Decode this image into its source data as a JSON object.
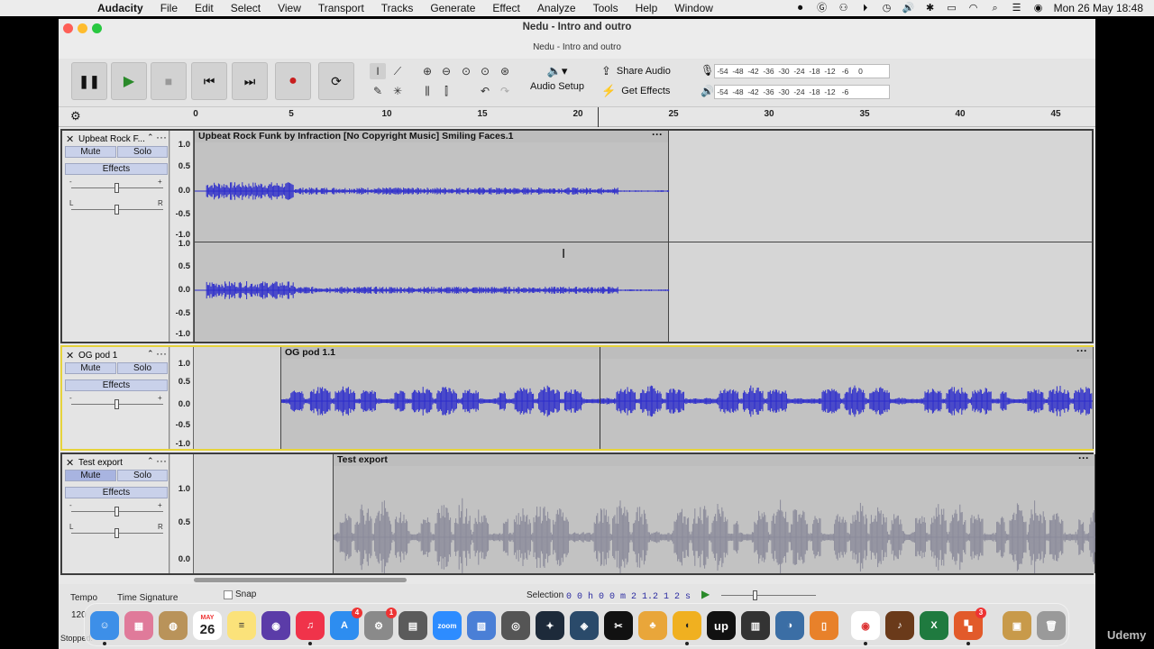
{
  "menubar": {
    "app_name": "Audacity",
    "items": [
      "File",
      "Edit",
      "Select",
      "View",
      "Transport",
      "Tracks",
      "Generate",
      "Effect",
      "Analyze",
      "Tools",
      "Help",
      "Window"
    ],
    "datetime": "Mon 26 May  18:48"
  },
  "window": {
    "title": "Nedu - Intro and outro",
    "subtitle": "Nedu - Intro and outro"
  },
  "toolbar": {
    "share_audio": "Share Audio",
    "get_effects": "Get Effects",
    "audio_setup": "Audio Setup",
    "meter_ticks": [
      "-54",
      "-48",
      "-42",
      "-36",
      "-30",
      "-24",
      "-18",
      "-12",
      "-6",
      "0"
    ],
    "meter_ticks_play": [
      "-54",
      "-48",
      "-42",
      "-36",
      "-30",
      "-24",
      "-18",
      "-12",
      "-6",
      ""
    ]
  },
  "ruler": {
    "ticks": [
      "0",
      "5",
      "10",
      "15",
      "20",
      "25",
      "30",
      "35",
      "40",
      "45"
    ]
  },
  "tracks": [
    {
      "name": "Upbeat Rock F...",
      "mute": "Mute",
      "solo": "Solo",
      "effects": "Effects",
      "clip_title": "Upbeat Rock Funk by Infraction [No Copyright Music]  Smiling Faces.1",
      "scale_top": [
        "1.0",
        "0.5",
        "0.0",
        "-0.5",
        "-1.0"
      ],
      "scale_bottom": [
        "1.0",
        "0.5",
        "0.0",
        "-0.5",
        "-1.0"
      ],
      "pan_l": "L",
      "pan_r": "R",
      "gain_minus": "-",
      "gain_plus": "+"
    },
    {
      "name": "OG pod 1",
      "mute": "Mute",
      "solo": "Solo",
      "effects": "Effects",
      "clip_title": "OG pod 1.1",
      "scale": [
        "1.0",
        "0.5",
        "0.0",
        "-0.5",
        "-1.0"
      ],
      "gain_minus": "-",
      "gain_plus": "+"
    },
    {
      "name": "Test export",
      "mute": "Mute",
      "solo": "Solo",
      "effects": "Effects",
      "clip_title": "Test export",
      "scale": [
        "1.0",
        "0.5",
        "0.0"
      ],
      "pan_l": "L",
      "pan_r": "R",
      "gain_minus": "-",
      "gain_plus": "+"
    }
  ],
  "bottom": {
    "tempo": "Tempo",
    "tempo_value": "120",
    "time_signature": "Time Signature",
    "snap": "Snap",
    "selection": "Selection",
    "selection_value": "0 0 h 0 0 m 2 1.2 1 2 s",
    "status": "Stopped."
  },
  "dock": {
    "calendar_month": "MAY",
    "calendar_day": "26",
    "badge_appstore": "4",
    "badge_settings": "1",
    "badge_office": "3"
  },
  "watermark": "Udemy",
  "colors": {
    "waveform": "#2c2ccb",
    "waveform_muted": "#8a8a9a",
    "selected_track": "#e6d33a",
    "record": "#c81e1e"
  }
}
